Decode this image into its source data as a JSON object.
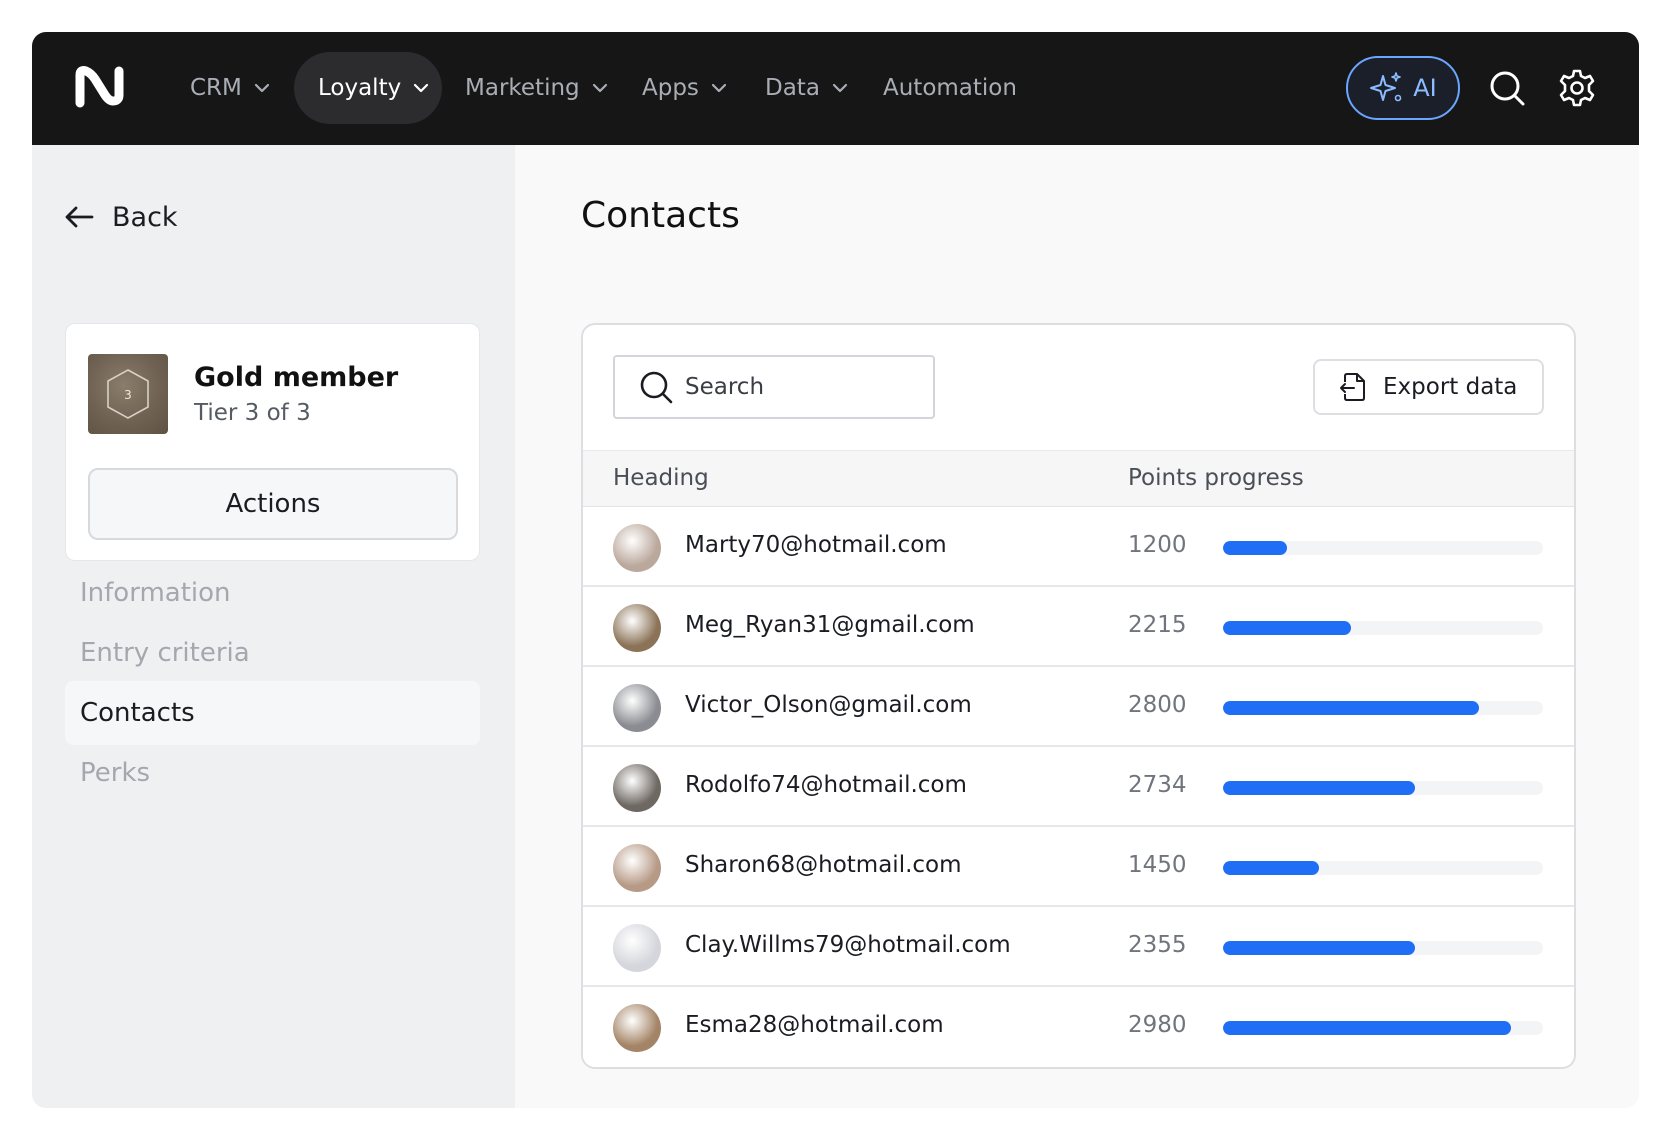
{
  "nav": {
    "items": [
      {
        "label": "CRM",
        "has_menu": true,
        "active": false
      },
      {
        "label": "Loyalty",
        "has_menu": true,
        "active": true
      },
      {
        "label": "Marketing",
        "has_menu": true,
        "active": false
      },
      {
        "label": "Apps",
        "has_menu": true,
        "active": false
      },
      {
        "label": "Data",
        "has_menu": true,
        "active": false
      },
      {
        "label": "Automation",
        "has_menu": false,
        "active": false
      }
    ],
    "ai_label": "AI",
    "icons": [
      "logo-icon",
      "sparkles-icon",
      "search-icon",
      "gear-icon"
    ]
  },
  "sidebar": {
    "back_label": "Back",
    "card": {
      "title": "Gold member",
      "subtitle": "Tier 3 of 3",
      "badge_number": "3",
      "actions_label": "Actions"
    },
    "menu": [
      {
        "label": "Information",
        "active": false
      },
      {
        "label": "Entry criteria",
        "active": false
      },
      {
        "label": "Contacts",
        "active": true
      },
      {
        "label": "Perks",
        "active": false
      }
    ]
  },
  "main": {
    "title": "Contacts",
    "search_placeholder": "Search",
    "export_label": "Export data",
    "columns": [
      "Heading",
      "Points progress"
    ],
    "rows": [
      {
        "email": "Marty70@hotmail.com",
        "points": "1200",
        "progress": 0.2,
        "avatar_color": "#bba89c"
      },
      {
        "email": "Meg_Ryan31@gmail.com",
        "points": "2215",
        "progress": 0.4,
        "avatar_color": "#8b7358"
      },
      {
        "email": "Victor_Olson@gmail.com",
        "points": "2800",
        "progress": 0.8,
        "avatar_color": "#8a8c92"
      },
      {
        "email": "Rodolfo74@hotmail.com",
        "points": "2734",
        "progress": 0.6,
        "avatar_color": "#6e6862"
      },
      {
        "email": "Sharon68@hotmail.com",
        "points": "1450",
        "progress": 0.3,
        "avatar_color": "#b79a86"
      },
      {
        "email": "Clay.Willms79@hotmail.com",
        "points": "2355",
        "progress": 0.6,
        "avatar_color": "#d5d6dc"
      },
      {
        "email": "Esma28@hotmail.com",
        "points": "2980",
        "progress": 0.9,
        "avatar_color": "#a48466"
      }
    ]
  },
  "colors": {
    "accent": "#1f6ef5",
    "topbar": "#161616",
    "ai_border": "#6aa6ff"
  }
}
